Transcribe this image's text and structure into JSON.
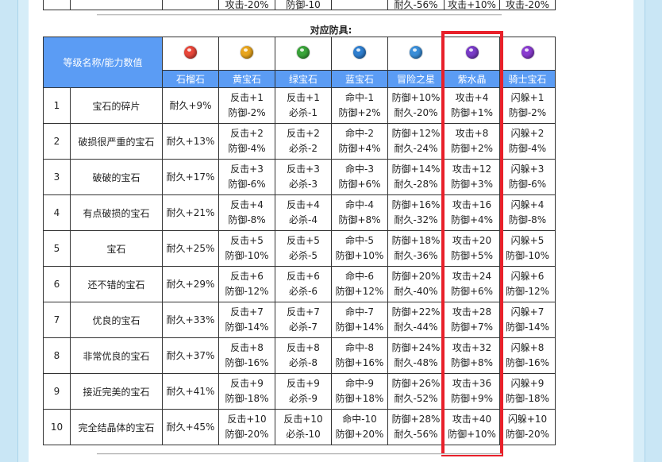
{
  "previous_table_tail": [
    "攻击-20%",
    "防御-10",
    "耐久-56%",
    "攻击+10%",
    "攻击-20%"
  ],
  "section_title": "对应防具:",
  "header": {
    "corner": "等级名称/能力数值"
  },
  "gems": [
    {
      "name": "石榴石",
      "color": "#e8473a",
      "icon": "red-gem-icon"
    },
    {
      "name": "黄宝石",
      "color": "#e8a51e",
      "icon": "yellow-gem-icon"
    },
    {
      "name": "绿宝石",
      "color": "#3aa43a",
      "icon": "green-gem-icon"
    },
    {
      "name": "蓝宝石",
      "color": "#2f7fd0",
      "icon": "blue-gem-icon"
    },
    {
      "name": "冒险之星",
      "color": "#3a8ed8",
      "icon": "adventure-star-icon"
    },
    {
      "name": "紫水晶",
      "color": "#7a3cc8",
      "icon": "amethyst-icon"
    },
    {
      "name": "骑士宝石",
      "color": "#8a3cd0",
      "icon": "knight-gem-icon"
    }
  ],
  "highlight_color": "#e8202a",
  "rows": [
    {
      "num": "1",
      "name": "宝石的碎片",
      "vals": [
        [
          "耐久+9%"
        ],
        [
          "反击+1",
          "防御-2%"
        ],
        [
          "反击+1",
          "必杀-1"
        ],
        [
          "命中-1",
          "防御+2%"
        ],
        [
          "防御+10%",
          "耐久-20%"
        ],
        [
          "攻击+4",
          "防御+1%"
        ],
        [
          "闪躲+1",
          "防御-2%"
        ]
      ]
    },
    {
      "num": "2",
      "name": "破损很严重的宝石",
      "vals": [
        [
          "耐久+13%"
        ],
        [
          "反击+2",
          "防御-4%"
        ],
        [
          "反击+2",
          "必杀-2"
        ],
        [
          "命中-2",
          "防御+4%"
        ],
        [
          "防御+12%",
          "耐久-24%"
        ],
        [
          "攻击+8",
          "防御+2%"
        ],
        [
          "闪躲+2",
          "防御-4%"
        ]
      ]
    },
    {
      "num": "3",
      "name": "破破的宝石",
      "vals": [
        [
          "耐久+17%"
        ],
        [
          "反击+3",
          "防御-6%"
        ],
        [
          "反击+3",
          "必杀-3"
        ],
        [
          "命中-3",
          "防御+6%"
        ],
        [
          "防御+14%",
          "耐久-28%"
        ],
        [
          "攻击+12",
          "防御+3%"
        ],
        [
          "闪躲+3",
          "防御-6%"
        ]
      ]
    },
    {
      "num": "4",
      "name": "有点破损的宝石",
      "vals": [
        [
          "耐久+21%"
        ],
        [
          "反击+4",
          "防御-8%"
        ],
        [
          "反击+4",
          "必杀-4"
        ],
        [
          "命中-4",
          "防御+8%"
        ],
        [
          "防御+16%",
          "耐久-32%"
        ],
        [
          "攻击+16",
          "防御+4%"
        ],
        [
          "闪躲+4",
          "防御-8%"
        ]
      ]
    },
    {
      "num": "5",
      "name": "宝石",
      "vals": [
        [
          "耐久+25%"
        ],
        [
          "反击+5",
          "防御-10%"
        ],
        [
          "反击+5",
          "必杀-5"
        ],
        [
          "命中-5",
          "防御+10%"
        ],
        [
          "防御+18%",
          "耐久-36%"
        ],
        [
          "攻击+20",
          "防御+5%"
        ],
        [
          "闪躲+5",
          "防御-10%"
        ]
      ]
    },
    {
      "num": "6",
      "name": "还不错的宝石",
      "vals": [
        [
          "耐久+29%"
        ],
        [
          "反击+6",
          "防御-12%"
        ],
        [
          "反击+6",
          "必杀-6"
        ],
        [
          "命中-6",
          "防御+12%"
        ],
        [
          "防御+20%",
          "耐久-40%"
        ],
        [
          "攻击+24",
          "防御+6%"
        ],
        [
          "闪躲+6",
          "防御-12%"
        ]
      ]
    },
    {
      "num": "7",
      "name": "优良的宝石",
      "vals": [
        [
          "耐久+33%"
        ],
        [
          "反击+7",
          "防御-14%"
        ],
        [
          "反击+7",
          "必杀-7"
        ],
        [
          "命中-7",
          "防御+14%"
        ],
        [
          "防御+22%",
          "耐久-44%"
        ],
        [
          "攻击+28",
          "防御+7%"
        ],
        [
          "闪躲+7",
          "防御-14%"
        ]
      ]
    },
    {
      "num": "8",
      "name": "非常优良的宝石",
      "vals": [
        [
          "耐久+37%"
        ],
        [
          "反击+8",
          "防御-16%"
        ],
        [
          "反击+8",
          "必杀-8"
        ],
        [
          "命中-8",
          "防御+16%"
        ],
        [
          "防御+24%",
          "耐久-48%"
        ],
        [
          "攻击+32",
          "防御+8%"
        ],
        [
          "闪躲+8",
          "防御-16%"
        ]
      ]
    },
    {
      "num": "9",
      "name": "接近完美的宝石",
      "vals": [
        [
          "耐久+41%"
        ],
        [
          "反击+9",
          "防御-18%"
        ],
        [
          "反击+9",
          "必杀-9"
        ],
        [
          "命中-9",
          "防御+18%"
        ],
        [
          "防御+26%",
          "耐久-52%"
        ],
        [
          "攻击+36",
          "防御+9%"
        ],
        [
          "闪躲+9",
          "防御-18%"
        ]
      ]
    },
    {
      "num": "10",
      "name": "完全结晶体的宝石",
      "vals": [
        [
          "耐久+45%"
        ],
        [
          "反击+10",
          "防御-20%"
        ],
        [
          "反击+10",
          "必杀-10"
        ],
        [
          "命中-10",
          "防御+20%"
        ],
        [
          "防御+28%",
          "耐久-56%"
        ],
        [
          "攻击+40",
          "防御+10%"
        ],
        [
          "闪躲+10",
          "防御-20%"
        ]
      ]
    }
  ]
}
